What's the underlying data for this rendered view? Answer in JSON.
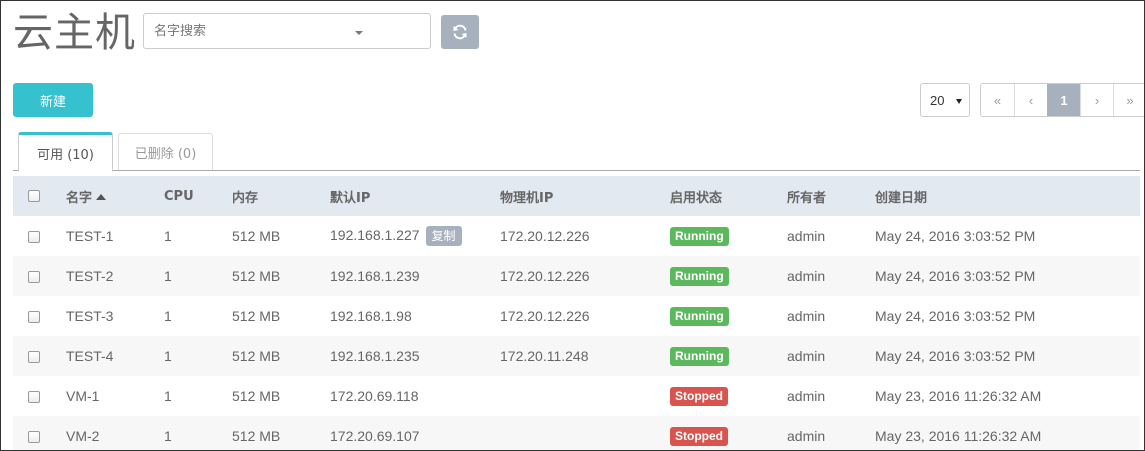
{
  "page": {
    "title": "云主机"
  },
  "search": {
    "placeholder": "名字搜索"
  },
  "toolbar": {
    "new_label": "新建"
  },
  "pagination": {
    "page_size": "20",
    "first": "«",
    "prev": "‹",
    "current": "1",
    "next": "›",
    "last": "»"
  },
  "tabs": [
    {
      "label": "可用 (10)"
    },
    {
      "label": "已删除 (0)"
    }
  ],
  "table": {
    "headers": [
      "名字",
      "CPU",
      "内存",
      "默认IP",
      "物理机IP",
      "启用状态",
      "所有者",
      "创建日期"
    ],
    "copy_label": "复制",
    "rows": [
      {
        "name": "TEST-1",
        "cpu": "1",
        "memory": "512 MB",
        "default_ip": "192.168.1.227",
        "host_ip": "172.20.12.226",
        "status": "Running",
        "owner": "admin",
        "created": "May 24, 2016 3:03:52 PM"
      },
      {
        "name": "TEST-2",
        "cpu": "1",
        "memory": "512 MB",
        "default_ip": "192.168.1.239",
        "host_ip": "172.20.12.226",
        "status": "Running",
        "owner": "admin",
        "created": "May 24, 2016 3:03:52 PM"
      },
      {
        "name": "TEST-3",
        "cpu": "1",
        "memory": "512 MB",
        "default_ip": "192.168.1.98",
        "host_ip": "172.20.12.226",
        "status": "Running",
        "owner": "admin",
        "created": "May 24, 2016 3:03:52 PM"
      },
      {
        "name": "TEST-4",
        "cpu": "1",
        "memory": "512 MB",
        "default_ip": "192.168.1.235",
        "host_ip": "172.20.11.248",
        "status": "Running",
        "owner": "admin",
        "created": "May 24, 2016 3:03:52 PM"
      },
      {
        "name": "VM-1",
        "cpu": "1",
        "memory": "512 MB",
        "default_ip": "172.20.69.118",
        "host_ip": "",
        "status": "Stopped",
        "owner": "admin",
        "created": "May 23, 2016 11:26:32 AM"
      },
      {
        "name": "VM-2",
        "cpu": "1",
        "memory": "512 MB",
        "default_ip": "172.20.69.107",
        "host_ip": "",
        "status": "Stopped",
        "owner": "admin",
        "created": "May 23, 2016 11:26:32 AM"
      }
    ]
  },
  "colors": {
    "accent": "#35c1cd",
    "running": "#5cb85c",
    "stopped": "#d9534f",
    "muted_button": "#a7b1bd",
    "header_bg": "#e3e9f1"
  },
  "icons": {
    "refresh": "refresh-icon",
    "sort": "sort-ascending-icon",
    "dropdown": "caret-down-icon"
  }
}
